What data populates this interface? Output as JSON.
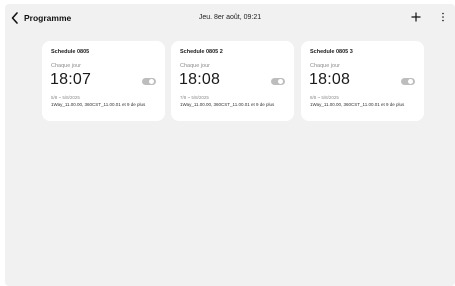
{
  "header": {
    "back_icon": "chevron-left-icon",
    "title": "Programme",
    "datetime": "Jeu. 8er août, 09:21",
    "add_icon": "plus-icon",
    "more_icon": "more-vertical-icon"
  },
  "schedules": [
    {
      "name": "Schedule 0805",
      "frequency": "Chaque jour",
      "time": "18:07",
      "enabled": false,
      "date_range": "5/8 ~ 5/8/2025",
      "description": "1Way_11.00.00, 360CST_11.00.01 et 9 de plus"
    },
    {
      "name": "Schedule 0805 2",
      "frequency": "Chaque jour",
      "time": "18:08",
      "enabled": false,
      "date_range": "7/8 ~ 5/8/2025",
      "description": "1Way_11.00.00, 360CST_11.00.01 et 9 de plus"
    },
    {
      "name": "Schedule 0805 3",
      "frequency": "Chaque jour",
      "time": "18:08",
      "enabled": false,
      "date_range": "8/8 ~ 5/8/2025",
      "description": "1Way_11.00.00, 360CST_11.00.01 et 9 de plus"
    }
  ],
  "colors": {
    "background": "#f1f1f1",
    "card": "#ffffff",
    "toggle_off": "#bdbdbd",
    "muted_text": "#8c8c8c"
  }
}
